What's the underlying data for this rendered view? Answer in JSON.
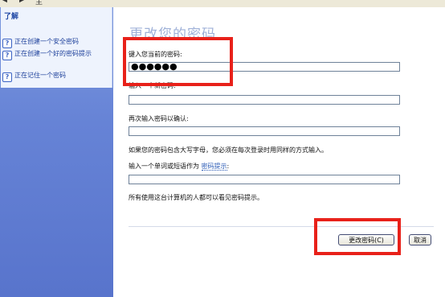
{
  "toolbar": {
    "items": [
      "",
      "",
      "主"
    ]
  },
  "sidebar": {
    "heading": "了解",
    "items": [
      {
        "label": "正在创建一个安全密码"
      },
      {
        "label": "正在创建一个好的密码提示"
      },
      {
        "label": "正在记住一个密码"
      }
    ]
  },
  "main": {
    "title": "更改您的密码",
    "current_password_label": "键入您当前的密码:",
    "current_password_value": "●●●●●●",
    "new_password_label": "输入一个新密码:",
    "new_password_value": "",
    "confirm_label": "再次输入密码以确认:",
    "confirm_value": "",
    "caps_note": "如果您的密码包含大写字母，您必须在每次登录时用同样的方式输入。",
    "hint_label_prefix": "输入一个单词或短语作为",
    "hint_link": "密码提示",
    "hint_label_suffix": ":",
    "hint_value": "",
    "hint_note": "所有使用这台计算机的人都可以看见密码提示。"
  },
  "buttons": {
    "change": "更改密码(C)",
    "cancel": "取消"
  },
  "colors": {
    "highlight": "#e8211a",
    "sidebar": "#6683d6",
    "title": "#9fb1d8"
  }
}
